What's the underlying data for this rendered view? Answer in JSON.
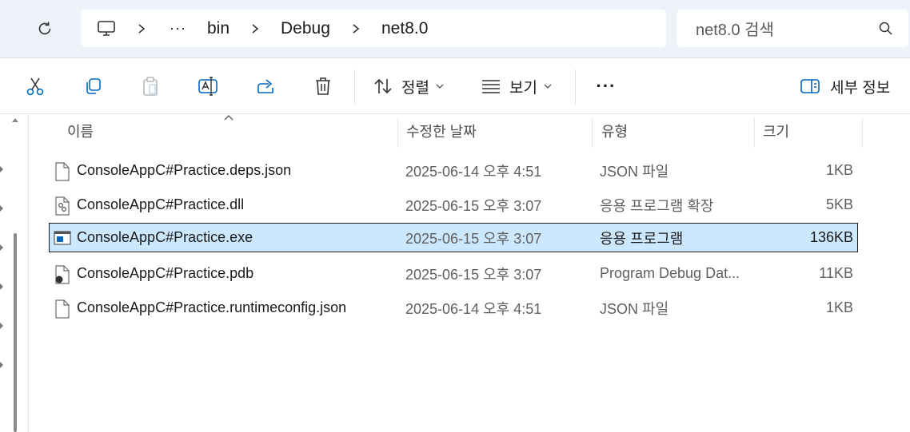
{
  "breadcrumb": {
    "ellipsis": "···",
    "items": [
      "bin",
      "Debug",
      "net8.0"
    ],
    "separator": "›"
  },
  "search": {
    "placeholder": "net8.0 검색"
  },
  "toolbar": {
    "sort_label": "정렬",
    "view_label": "보기",
    "more_label": "···",
    "details_label": "세부 정보"
  },
  "columns": {
    "name": "이름",
    "modified": "수정한 날짜",
    "type": "유형",
    "size": "크기"
  },
  "files": [
    {
      "name": "ConsoleAppC#Practice.deps.json",
      "modified": "2025-06-14 오후 4:51",
      "type": "JSON 파일",
      "size": "1KB",
      "icon": "json-file-icon"
    },
    {
      "name": "ConsoleAppC#Practice.dll",
      "modified": "2025-06-15 오후 3:07",
      "type": "응용 프로그램 확장",
      "size": "5KB",
      "icon": "dll-file-icon"
    },
    {
      "name": "ConsoleAppC#Practice.exe",
      "modified": "2025-06-15 오후 3:07",
      "type": "응용 프로그램",
      "size": "136KB",
      "icon": "exe-file-icon",
      "selected": true
    },
    {
      "name": "ConsoleAppC#Practice.pdb",
      "modified": "2025-06-15 오후 3:07",
      "type": "Program Debug Dat...",
      "size": "11KB",
      "icon": "pdb-file-icon"
    },
    {
      "name": "ConsoleAppC#Practice.runtimeconfig.json",
      "modified": "2025-06-14 오후 4:51",
      "type": "JSON 파일",
      "size": "1KB",
      "icon": "json-file-icon"
    }
  ],
  "colors": {
    "addr_bg": "#eef3f9",
    "selection": "#cce8ff",
    "accent": "#0067c0"
  }
}
